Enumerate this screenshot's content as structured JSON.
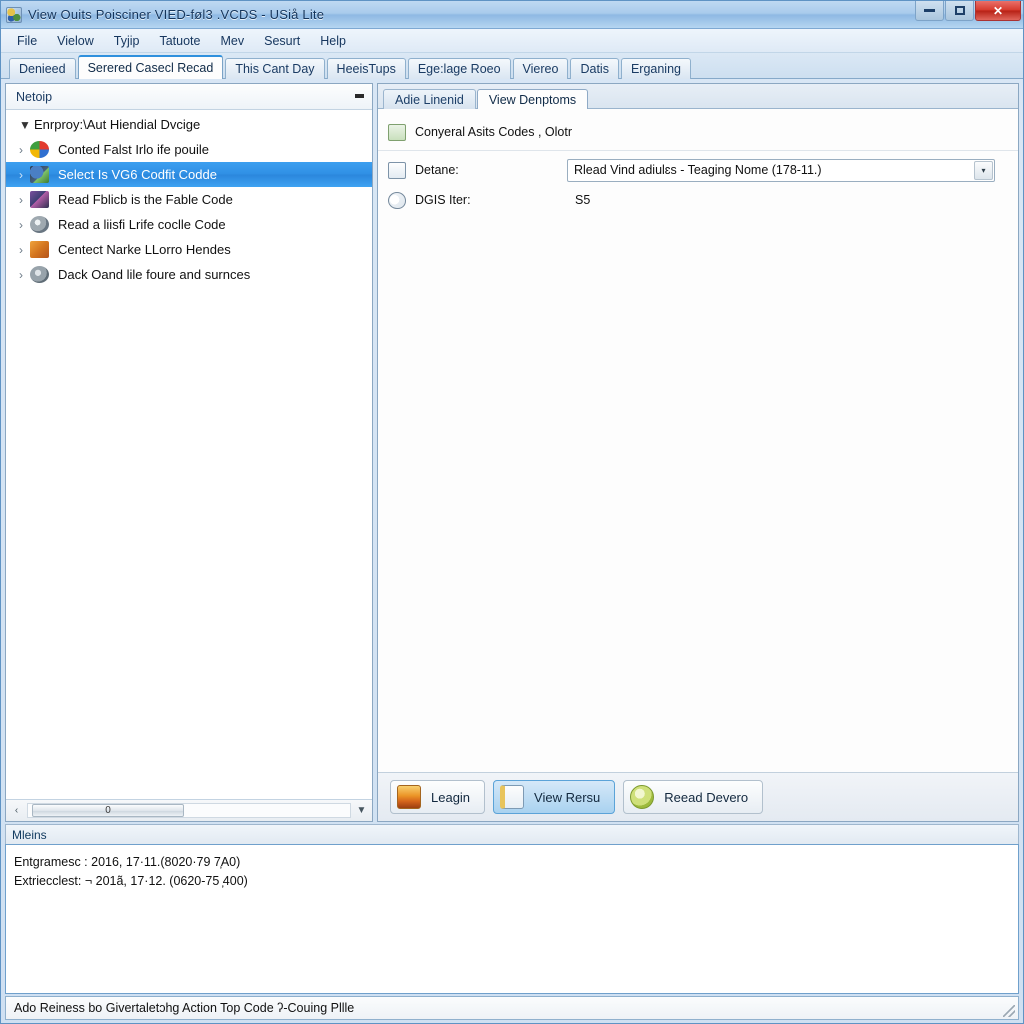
{
  "window": {
    "title": "View Ouits Poisciner VIED-føl3   .VCDS - USiå Lite",
    "icon": "app-icon",
    "buttons": {
      "minimize": "–",
      "maximize": "□",
      "close": "✕"
    }
  },
  "menubar": {
    "items": [
      "File",
      "Vielow",
      "Tyjip",
      "Tatuote",
      "Mev",
      "Sesurt",
      "Help"
    ]
  },
  "tabstrip": {
    "tabs": [
      {
        "label": "Denieed",
        "active": false
      },
      {
        "label": "Serered Casecl Recad",
        "active": true
      },
      {
        "label": "This Cant Day",
        "active": false
      },
      {
        "label": "HeeisTups",
        "active": false
      },
      {
        "label": "Ege:lage Roeo",
        "active": false
      },
      {
        "label": "Viereo",
        "active": false
      },
      {
        "label": "Datis",
        "active": false
      },
      {
        "label": "Erganing",
        "active": false
      }
    ]
  },
  "tree": {
    "header": "Netoip",
    "items": [
      {
        "label": "Enrproy:\\Aut Hiendial Dvcige",
        "twisty": "▼",
        "icon": "none",
        "selected": false,
        "root": true
      },
      {
        "label": "Conted Falst Irlo ife pouile",
        "twisty": "›",
        "icon": "pinwheel-icon",
        "selected": false,
        "root": false
      },
      {
        "label": "Select Is VG6 Codfit Codde",
        "twisty": "›",
        "icon": "car-blue-icon",
        "selected": true,
        "root": false
      },
      {
        "label": "Read Fblicb is the Fable Code",
        "twisty": "›",
        "icon": "chip-purple-icon",
        "selected": false,
        "root": false
      },
      {
        "label": "Read a liisfi Lrife coclle Code",
        "twisty": "›",
        "icon": "globe-grey-icon",
        "selected": false,
        "root": false
      },
      {
        "label": "Centect Narke LLorro Hendes",
        "twisty": "›",
        "icon": "orange-icon",
        "selected": false,
        "root": false
      },
      {
        "label": "Dack Oand lile foure and surnces",
        "twisty": "›",
        "icon": "grey-disc-icon",
        "selected": false,
        "root": false
      }
    ],
    "scrollbar": {
      "left_arrow": "‹",
      "thumb_label": "0",
      "right_arrow": "▼"
    }
  },
  "rightpane": {
    "subtabs": [
      {
        "label": "Adie Linenid",
        "active": false
      },
      {
        "label": "View  Denptoms",
        "active": true
      }
    ],
    "form": {
      "heading_icon": "document-icon",
      "heading": "Conyeral Asits Codes ,  Olotr",
      "rows": [
        {
          "icon": "folder-icon",
          "label": "Detane:",
          "control": "dropdown",
          "value": "Rlead Vind adiulɛs - Teaging Nome (178-11.)",
          "arrow": "▾"
        },
        {
          "icon": "tag-icon",
          "label": "DGIS Iter:",
          "control": "text",
          "value": "S5"
        }
      ]
    },
    "buttons": [
      {
        "label": "Leagin",
        "icon": "sunset-icon",
        "selected": false
      },
      {
        "label": "View Rersu",
        "icon": "window-icon",
        "selected": true
      },
      {
        "label": "Reead Devero",
        "icon": "green-circle-icon",
        "selected": false
      }
    ]
  },
  "log": {
    "title": "Mleins",
    "lines": [
      "Entgramesc : 2016, 17·11.(8020·79  7̦A0)",
      "Extriecclest: ¬ 201ã, 17·12. (0620-75 ̦400)"
    ]
  },
  "statusbar": {
    "text": "Ado Reiness bo Givertaletɔhg Action Top Code ʔ-Couing Pllle"
  }
}
